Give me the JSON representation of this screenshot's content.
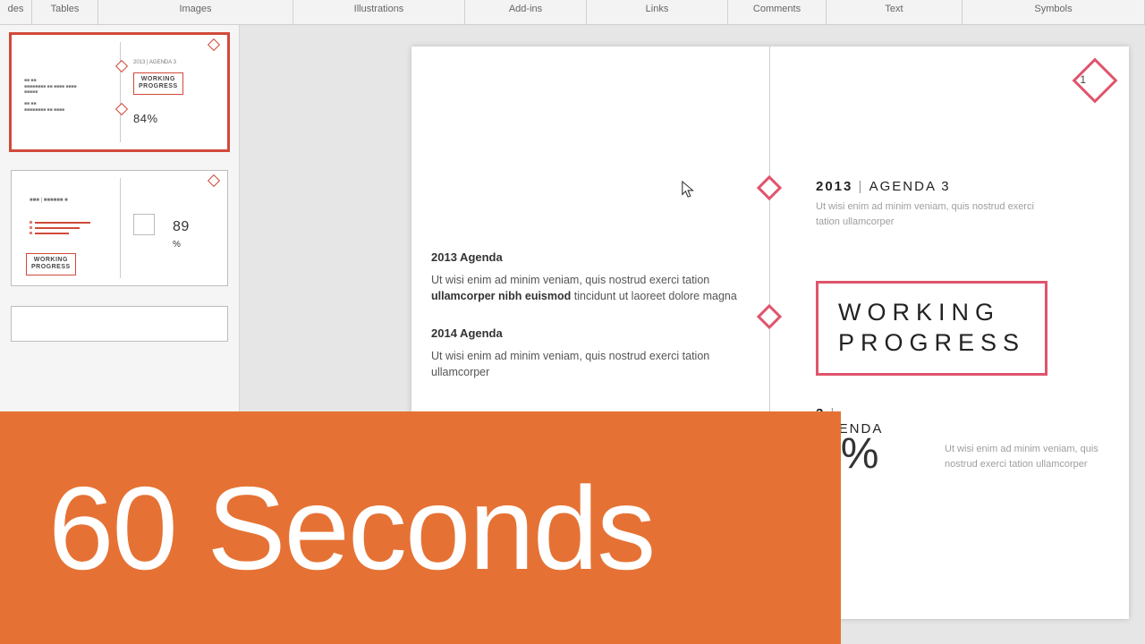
{
  "ribbon": {
    "groups": [
      "des",
      "Tables",
      "Images",
      "Illustrations",
      "Add-ins",
      "Links",
      "Comments",
      "Text",
      "Symbols"
    ]
  },
  "thumbnails": {
    "slide1": {
      "agenda_label": "2013 | AGENDA 3",
      "box_l1": "WORKING",
      "box_l2": "PROGRESS",
      "pct": "84%"
    },
    "slide2": {
      "num": "89",
      "pct_sym": "%",
      "box_l1": "WORKING",
      "box_l2": "PROGRESS"
    }
  },
  "slide": {
    "page_number": "1",
    "left": {
      "h1": "2013 Agenda",
      "p1_a": "Ut wisi enim ad minim veniam, quis nostrud exerci tation ",
      "p1_b": "ullamcorper nibh euismod",
      "p1_c": " tincidunt ut laoreet dolore magna",
      "h2": "2014 Agenda",
      "p2": "Ut wisi enim ad minim veniam, quis nostrud exerci tation ullamcorper"
    },
    "right": {
      "title_year": "2013",
      "title_rest": "AGENDA 3",
      "sub": "Ut wisi enim ad minim veniam, quis nostrud exerci tation ullamcorper",
      "box_l1": "WORKING",
      "box_l2": "PROGRESS",
      "pct_val": "4%",
      "pct_year": "3",
      "pct_rest": "AGENDA 3",
      "pct_sub": "Ut wisi enim ad minim veniam, quis nostrud exerci tation ullamcorper"
    }
  },
  "banner": {
    "text": "60 Seconds"
  }
}
